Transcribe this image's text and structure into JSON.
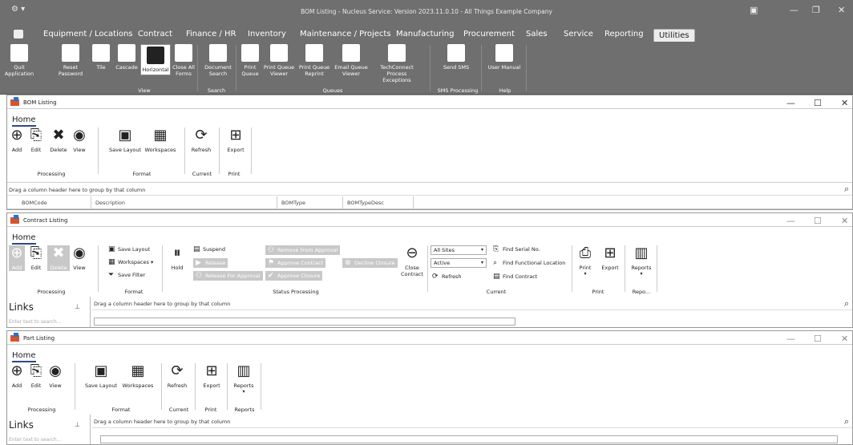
{
  "window": {
    "title": "BOM Listing - Nucleus Service: Version 2023.11.0.10 - All Things Example Company"
  },
  "menu": [
    "Equipment / Locations",
    "Contract",
    "Finance / HR",
    "Inventory",
    "Maintenance / Projects",
    "Manufacturing",
    "Procurement",
    "Sales",
    "Service",
    "Reporting",
    "Utilities"
  ],
  "ribbon": {
    "buttons": [
      "Quit Application",
      "Reset Password",
      "Tile",
      "Cascade",
      "Horizontal",
      "Close All Forms",
      "Document Search",
      "Print Queue",
      "Print Queue Viewer",
      "Print Queue Reprint",
      "Email Queue Viewer",
      "TechConnect Process Exceptions",
      "Send SMS",
      "User Manual"
    ],
    "groups": [
      "View",
      "Search",
      "Queues",
      "SMS Processing",
      "Help"
    ]
  },
  "bom": {
    "title": "BOM Listing",
    "home": "Home",
    "buttons": [
      "Add",
      "Edit",
      "Delete",
      "View",
      "Save Layout",
      "Workspaces",
      "Refresh",
      "Export"
    ],
    "groups": [
      "Processing",
      "Format",
      "Current",
      "Print"
    ],
    "drag": "Drag a column header here to group by that column",
    "columns": [
      "BOMCode",
      "Description",
      "BOMType",
      "BOMTypeDesc"
    ]
  },
  "contract": {
    "title": "Contract Listing",
    "home": "Home",
    "buttons": [
      "Add",
      "Edit",
      "Delete",
      "View",
      "Save Layout",
      "Workspaces",
      "Save Filter",
      "Hold",
      "Suspend",
      "Release",
      "Release For Approval",
      "Remove From Approval",
      "Approve Contract",
      "Approve Closure",
      "Decline Closure",
      "Close Contract",
      "Find Serial No.",
      "Find Functional Location",
      "Refresh",
      "Find Contract",
      "Print",
      "Export",
      "Reports"
    ],
    "filters": {
      "site": "All Sites",
      "status": "Active"
    },
    "groups": [
      "Processing",
      "Format",
      "Status Processing",
      "Current",
      "Print",
      "Repo..."
    ],
    "links": "Links",
    "search": "Enter text to search...",
    "drag": "Drag a column header here to group by that column"
  },
  "part": {
    "title": "Part Listing",
    "home": "Home",
    "buttons": [
      "Add",
      "Edit",
      "View",
      "Save Layout",
      "Workspaces",
      "Refresh",
      "Export",
      "Reports"
    ],
    "groups": [
      "Processing",
      "Format",
      "Current",
      "Print",
      "Reports"
    ],
    "links": "Links",
    "search": "Enter text to search...",
    "drag": "Drag a column header here to group by that column"
  }
}
